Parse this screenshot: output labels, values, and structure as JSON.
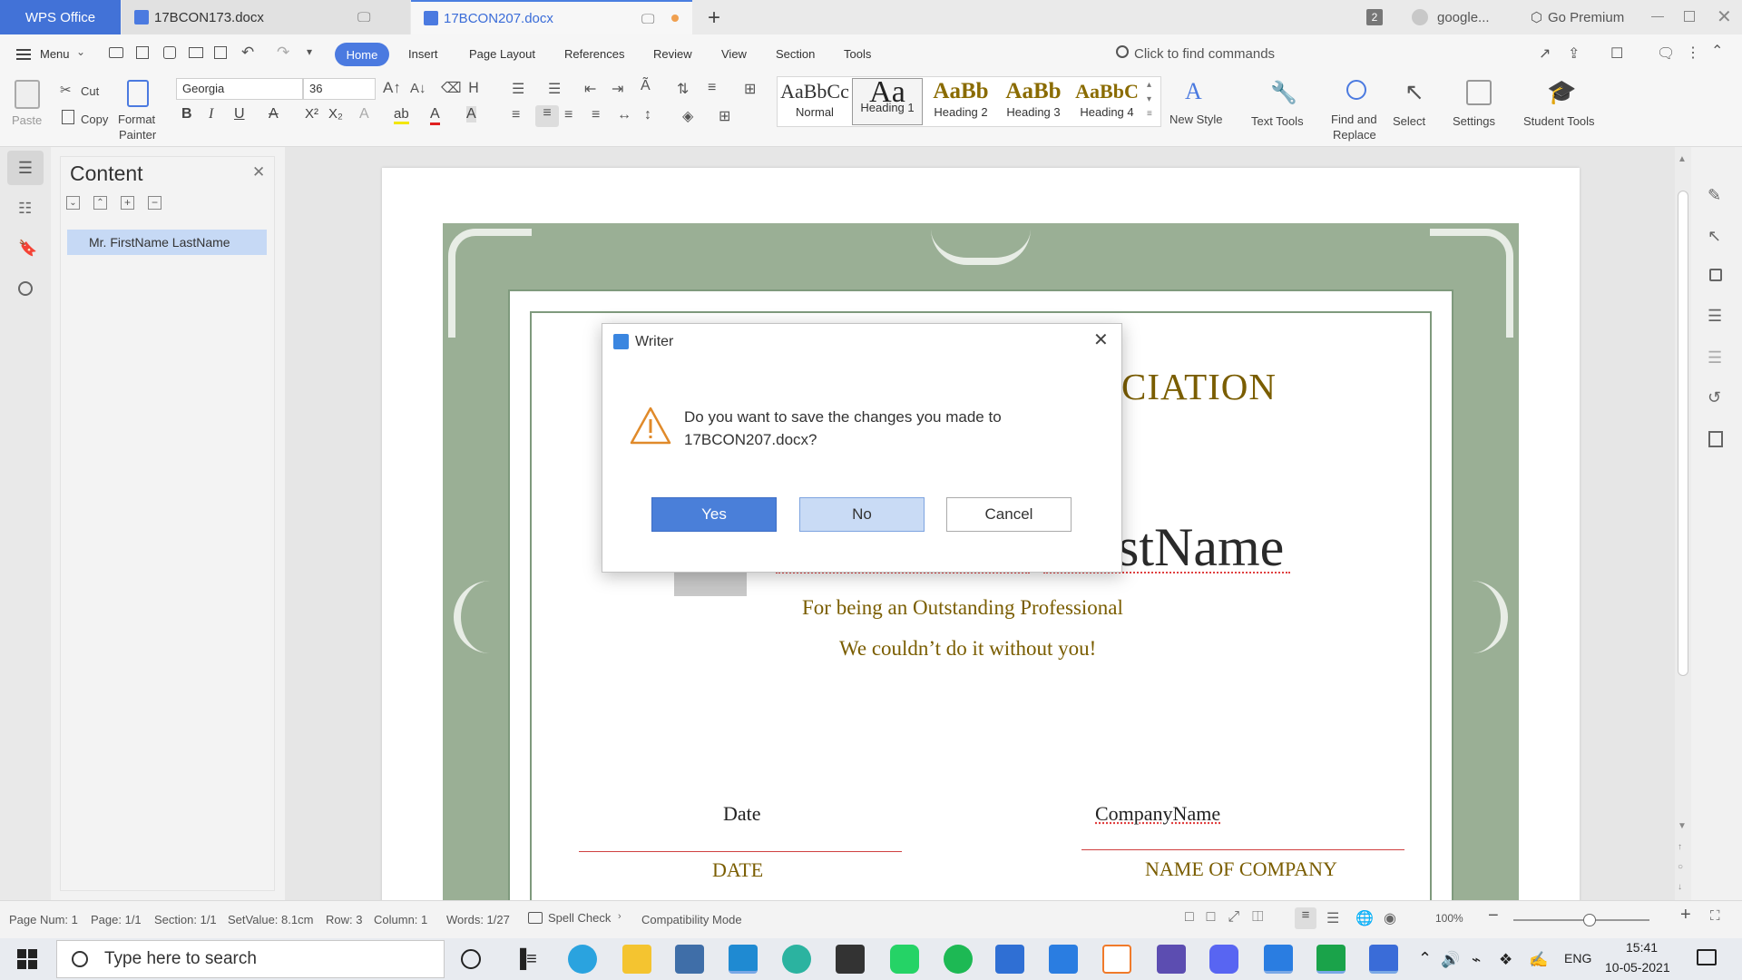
{
  "titlebar": {
    "brand": "WPS Office",
    "tabs": [
      {
        "label": "17BCON173.docx"
      },
      {
        "label": "17BCON207.docx"
      }
    ],
    "badge_count": "2",
    "account": "google...",
    "premium": "Go Premium"
  },
  "menu": {
    "menu_label": "Menu",
    "tabs": [
      "Home",
      "Insert",
      "Page Layout",
      "References",
      "Review",
      "View",
      "Section",
      "Tools"
    ],
    "find_commands": "Click to find commands"
  },
  "ribbon": {
    "paste": "Paste",
    "cut": "Cut",
    "copy": "Copy",
    "format_painter": [
      "Format",
      "Painter"
    ],
    "font": "Georgia",
    "font_size": "36",
    "styles": [
      {
        "preview": "AaBbCc",
        "label": "Normal"
      },
      {
        "preview": "Aa",
        "label": "Heading 1"
      },
      {
        "preview": "AaBb",
        "label": "Heading 2"
      },
      {
        "preview": "AaBb",
        "label": "Heading 3"
      },
      {
        "preview": "AaBbC",
        "label": "Heading 4"
      }
    ],
    "new_style": "New Style",
    "text_tools": "Text Tools",
    "find_replace": [
      "Find and",
      "Replace"
    ],
    "select": "Select",
    "settings": "Settings",
    "student_tools": "Student Tools"
  },
  "nav_panel": {
    "title": "Content",
    "items": [
      "Mr. FirstName LastName"
    ]
  },
  "document": {
    "heading_partial": "CIATION",
    "name_partial": "stName",
    "line1": "For being an Outstanding Professional",
    "line2": "We couldn’t do it without you!",
    "date_label": "Date",
    "date_value": "DATE",
    "company_label": "CompanyName",
    "company_value": "NAME OF COMPANY"
  },
  "dialog": {
    "title": "Writer",
    "message_line1": "Do you want to save the changes you made to",
    "message_line2": "17BCON207.docx?",
    "yes": "Yes",
    "no": "No",
    "cancel": "Cancel"
  },
  "statusbar": {
    "page_num": "Page Num: 1",
    "page": "Page: 1/1",
    "section": "Section: 1/1",
    "setvalue": "SetValue: 8.1cm",
    "row": "Row: 3",
    "column": "Column: 1",
    "words": "Words: 1/27",
    "spell_check": "Spell Check",
    "compat": "Compatibility Mode",
    "zoom": "100%"
  },
  "taskbar": {
    "search_placeholder": "Type here to search",
    "lang": "ENG",
    "time": "15:41",
    "date": "10-05-2021"
  },
  "colors": {
    "accent": "#4b7ae0",
    "cert_green": "#9aaf95",
    "cert_gold": "#8a6b00"
  }
}
